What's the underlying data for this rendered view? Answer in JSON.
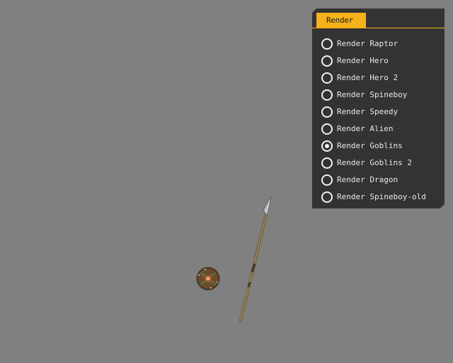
{
  "panel": {
    "tab_label": "Render",
    "accent_color": "#f5b21a",
    "background_color": "#333333",
    "options": [
      {
        "label": "Render Raptor",
        "selected": false
      },
      {
        "label": "Render Hero",
        "selected": false
      },
      {
        "label": "Render Hero 2",
        "selected": false
      },
      {
        "label": "Render Spineboy",
        "selected": false
      },
      {
        "label": "Render Speedy",
        "selected": false
      },
      {
        "label": "Render Alien",
        "selected": false
      },
      {
        "label": "Render Goblins",
        "selected": true
      },
      {
        "label": "Render Goblins 2",
        "selected": false
      },
      {
        "label": "Render Dragon",
        "selected": false
      },
      {
        "label": "Render Spineboy-old",
        "selected": false
      }
    ]
  },
  "scene": {
    "background_color": "#808080",
    "objects": [
      "spear-icon",
      "shield-icon"
    ]
  }
}
